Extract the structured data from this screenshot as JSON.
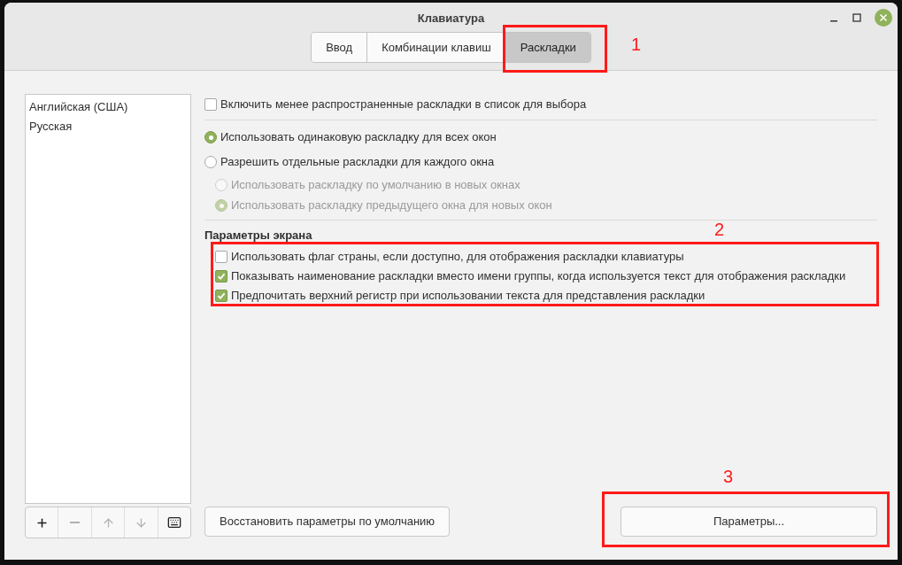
{
  "window": {
    "title": "Клавиатура"
  },
  "tabs": [
    {
      "label": "Ввод",
      "selected": false
    },
    {
      "label": "Комбинации клавиш",
      "selected": false
    },
    {
      "label": "Раскладки",
      "selected": true
    }
  ],
  "layouts": [
    {
      "label": "Английская (США)"
    },
    {
      "label": "Русская"
    }
  ],
  "layout_tools": [
    {
      "kind": "add",
      "disabled": false
    },
    {
      "kind": "remove",
      "disabled": true
    },
    {
      "kind": "up",
      "disabled": true
    },
    {
      "kind": "down",
      "disabled": true
    },
    {
      "kind": "keyboard",
      "disabled": false
    }
  ],
  "options": [
    {
      "kind": "checkbox",
      "label": "Включить менее распространенные раскладки в список для выбора",
      "checked": false,
      "disabled": false,
      "indent": false,
      "divider_after": true
    },
    {
      "kind": "radio",
      "label": "Использовать одинаковую раскладку для всех окон",
      "selected": true,
      "disabled": false,
      "indent": false,
      "divider_after": false
    },
    {
      "kind": "radio",
      "label": "Разрешить отдельные раскладки для каждого окна",
      "selected": false,
      "disabled": false,
      "indent": false,
      "divider_after": false
    },
    {
      "kind": "radio",
      "label": "Использовать раскладку по умолчанию в новых окнах",
      "selected": false,
      "disabled": true,
      "indent": true,
      "divider_after": false
    },
    {
      "kind": "radio",
      "label": "Использовать раскладку предыдущего окна для новых окон",
      "selected": true,
      "disabled": true,
      "indent": true,
      "divider_after": true
    }
  ],
  "display": {
    "heading": "Параметры экрана",
    "options": [
      {
        "label": "Использовать флаг страны, если доступно, для отображения раскладки клавиатуры",
        "checked": false
      },
      {
        "label": "Показывать наименование раскладки вместо имени группы, когда используется текст для отображения раскладки",
        "checked": true
      },
      {
        "label": "Предпочитать верхний регистр при использовании текста для представления раскладки",
        "checked": true
      }
    ]
  },
  "buttons": {
    "reset": "Восстановить параметры по умолчанию",
    "settings": "Параметры..."
  },
  "annotations": [
    {
      "label": "1"
    },
    {
      "label": "2"
    },
    {
      "label": "3"
    }
  ]
}
